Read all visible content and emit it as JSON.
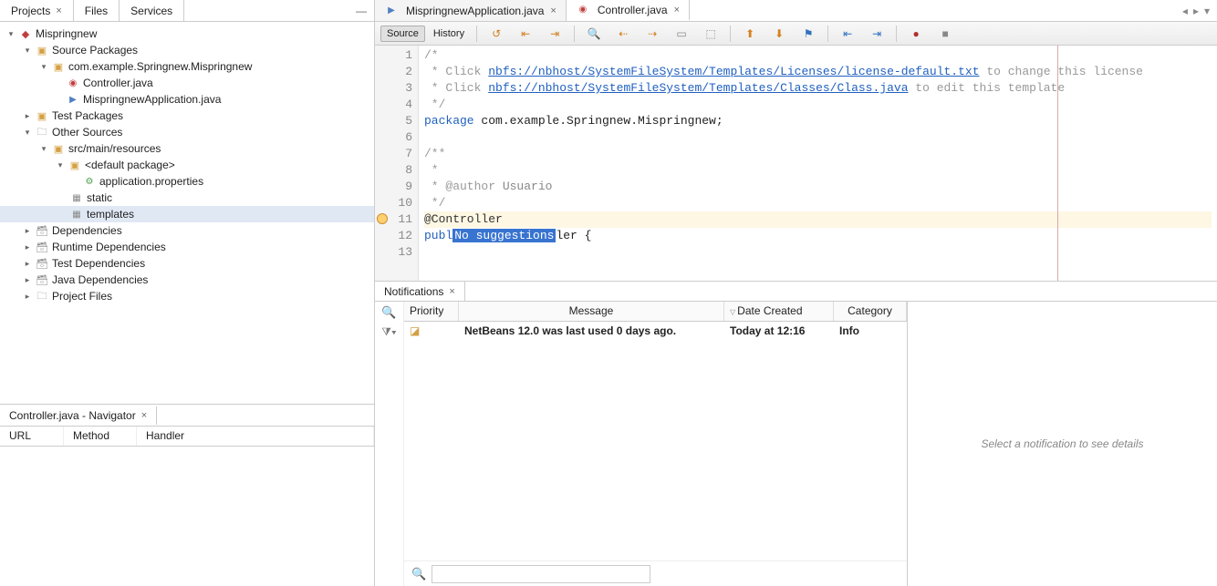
{
  "left_tabs": {
    "projects": "Projects",
    "files": "Files",
    "services": "Services"
  },
  "tree": {
    "root": "Mispringnew",
    "source_packages": "Source Packages",
    "pkg": "com.example.Springnew.Mispringnew",
    "controller": "Controller.java",
    "app": "MispringnewApplication.java",
    "test_packages": "Test Packages",
    "other_sources": "Other Sources",
    "src_main_res": "src/main/resources",
    "default_pkg": "<default package>",
    "app_props": "application.properties",
    "static": "static",
    "templates": "templates",
    "deps": "Dependencies",
    "rt_deps": "Runtime Dependencies",
    "test_deps": "Test Dependencies",
    "java_deps": "Java Dependencies",
    "project_files": "Project Files"
  },
  "navigator": {
    "title": "Controller.java - Navigator",
    "url": "URL",
    "method": "Method",
    "handler": "Handler"
  },
  "editor_tabs": {
    "tab1": "MispringnewApplication.java",
    "tab2": "Controller.java"
  },
  "toolbar": {
    "source": "Source",
    "history": "History"
  },
  "code": {
    "l1": "/*",
    "l2a": " * Click ",
    "l2b": "nbfs://nbhost/SystemFileSystem/Templates/Licenses/license-default.txt",
    "l2c": " to change this license",
    "l3a": " * Click ",
    "l3b": "nbfs://nbhost/SystemFileSystem/Templates/Classes/Class.java",
    "l3c": " to edit this template",
    "l4": " */",
    "l5a": "package",
    "l5b": " com.example.Springnew.Mispringnew;",
    "l6": "",
    "l7": "/**",
    "l8": " *",
    "l9a": " * @author ",
    "l9b": "Usuario",
    "l10": " */",
    "l11": "@Controller",
    "l12a": "publ",
    "l12s": "No suggestions",
    "l12b": "ler {",
    "l13": ""
  },
  "gutter": [
    "1",
    "2",
    "3",
    "4",
    "5",
    "6",
    "7",
    "8",
    "9",
    "10",
    "11",
    "12",
    "13"
  ],
  "notifications": {
    "title": "Notifications",
    "cols": {
      "priority": "Priority",
      "message": "Message",
      "date": "Date Created",
      "category": "Category"
    },
    "row": {
      "message": "NetBeans 12.0 was last used 0 days ago.",
      "date": "Today at 12:16",
      "category": "Info"
    },
    "details_hint": "Select a notification to see details"
  }
}
